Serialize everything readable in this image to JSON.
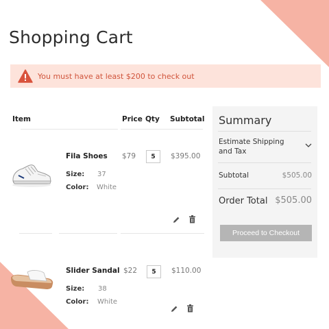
{
  "page": {
    "title": "Shopping Cart"
  },
  "alert": {
    "message": "You must have at least $200 to check out",
    "icon": "warning-icon"
  },
  "table": {
    "headers": {
      "item": "Item",
      "price": "Price",
      "qty": "Qty",
      "subtotal": "Subtotal"
    }
  },
  "items": [
    {
      "name": "Fila Shoes",
      "size_label": "Size:",
      "size": "37",
      "color_label": "Color:",
      "color": "White",
      "price": "$79",
      "qty": "5",
      "subtotal": "$395.00"
    },
    {
      "name": "Slider Sandal",
      "size_label": "Size:",
      "size": "38",
      "color_label": "Color:",
      "color": "White",
      "price": "$22",
      "qty": "5",
      "subtotal": "$110.00"
    }
  ],
  "summary": {
    "title": "Summary",
    "estimate_label": "Estimate Shipping and Tax",
    "subtotal_label": "Subtotal",
    "subtotal_value": "$505.00",
    "total_label": "Order Total",
    "total_value": "$505.00",
    "checkout_label": "Proceed to Checkout"
  },
  "colors": {
    "accent": "#f6b3a4",
    "alert_bg": "#fde3db",
    "alert_text": "#d0543b",
    "button": "#b5b5b5"
  }
}
